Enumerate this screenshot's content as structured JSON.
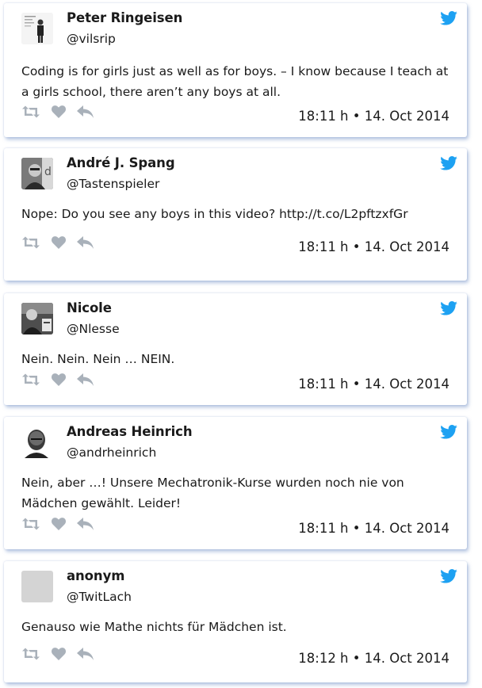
{
  "colors": {
    "twitter_blue": "#1da1f2",
    "action_gray": "#a9b1ba",
    "card_shadow": "#7896c8"
  },
  "icons": {
    "brand": "twitter-bird-icon",
    "retweet": "retweet-icon",
    "like": "heart-icon",
    "reply": "reply-icon"
  },
  "tweets": [
    {
      "name": "Peter Ringeisen",
      "handle": "@vilsrip",
      "text": "Coding is for girls just as well as for boys. – I know because I teach at a girls school, there aren’t any boys at all.",
      "time": "18:11 h  •  14. Oct 2014"
    },
    {
      "name": "André J. Spang",
      "handle": "@Tastenspieler",
      "text": "Nope: Do you see any boys in this video? http://t.co/L2pftzxfGr",
      "time": "18:11 h  •  14. Oct 2014"
    },
    {
      "name": "Nicole",
      "handle": "@Nlesse",
      "text": "Nein. Nein. Nein … NEIN.",
      "time": "18:11 h  •  14. Oct 2014"
    },
    {
      "name": "Andreas Heinrich",
      "handle": "@andrheinrich",
      "text": "Nein, aber …! Unsere Mechatronik-Kurse wurden noch nie von Mädchen gewählt. Leider!",
      "time": "18:11 h  •  14. Oct 2014"
    },
    {
      "name": "anonym",
      "handle": "@TwitLach",
      "text": "Genauso wie Mathe nichts für Mädchen ist.",
      "time": "18:12 h  •  14. Oct 2014"
    }
  ]
}
